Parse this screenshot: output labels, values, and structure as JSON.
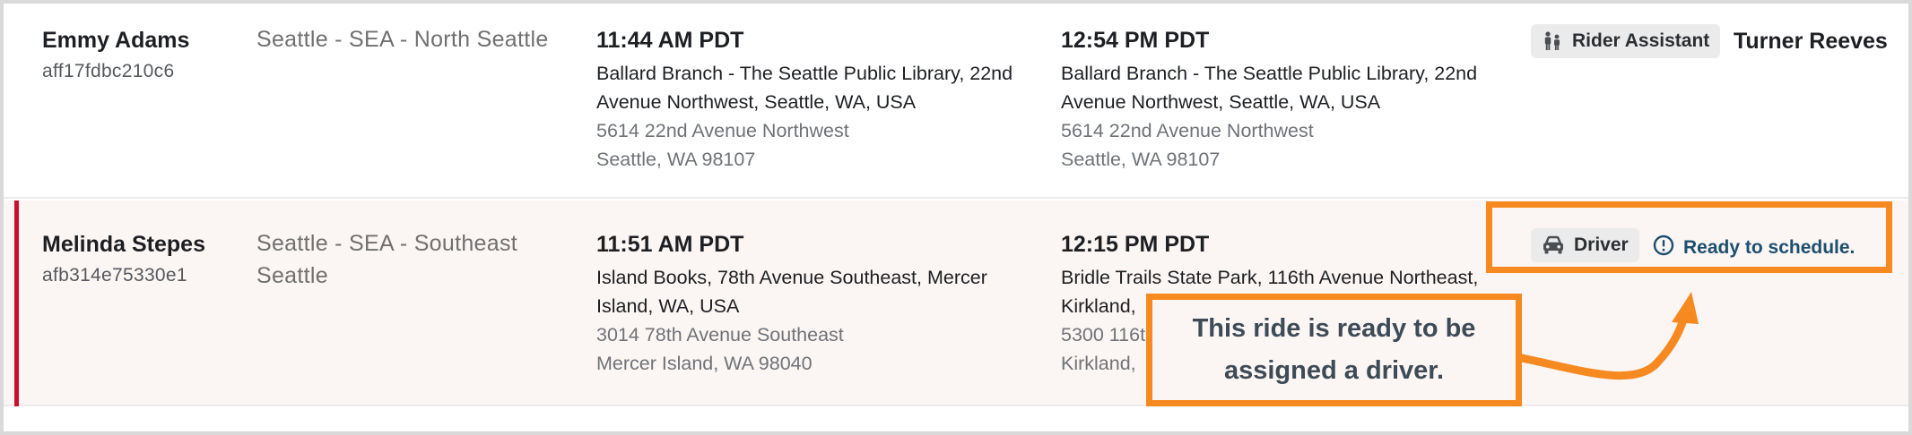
{
  "rides": [
    {
      "rider_name": "Emmy Adams",
      "ride_id": "aff17fdbc210c6",
      "region_line1": "Seattle - SEA - North Seattle",
      "region_line2": "",
      "pickup": {
        "time": "11:44 AM PDT",
        "place_line1": "Ballard Branch - The Seattle Public Library, 22nd",
        "place_line2": "Avenue Northwest, Seattle, WA, USA",
        "addr_line1": "5614 22nd Avenue Northwest",
        "addr_line2": "Seattle, WA 98107"
      },
      "dropoff": {
        "time": "12:54 PM PDT",
        "place_line1": "Ballard Branch - The Seattle Public Library, 22nd",
        "place_line2": "Avenue Northwest, Seattle, WA, USA",
        "addr_line1": "5614 22nd Avenue Northwest",
        "addr_line2": "Seattle, WA 98107"
      },
      "assignment": {
        "chip_label": "Rider Assistant",
        "chip_icon": "rider-assistant-icon",
        "assignee": "Turner Reeves"
      }
    },
    {
      "rider_name": "Melinda Stepes",
      "ride_id": "afb314e75330e1",
      "region_line1": "Seattle - SEA - Southeast",
      "region_line2": "Seattle",
      "pickup": {
        "time": "11:51 AM PDT",
        "place_line1": "Island Books, 78th Avenue Southeast, Mercer",
        "place_line2": "Island, WA, USA",
        "addr_line1": "3014 78th Avenue Southeast",
        "addr_line2": "Mercer Island, WA 98040"
      },
      "dropoff": {
        "time": "12:15 PM PDT",
        "place_line1": "Bridle Trails State Park, 116th Avenue Northeast,",
        "place_line2": "Kirkland,",
        "addr_line1": "5300 116t",
        "addr_line2": "Kirkland,"
      },
      "assignment": {
        "chip_label": "Driver",
        "chip_icon": "car-icon",
        "status": "Ready to schedule.",
        "status_icon": "info-circle-icon"
      }
    }
  ],
  "annotation": {
    "callout_text": "This ride is ready to be assigned a driver.",
    "accent_color": "#f6891f",
    "row_flag_color": "#c8102e"
  }
}
